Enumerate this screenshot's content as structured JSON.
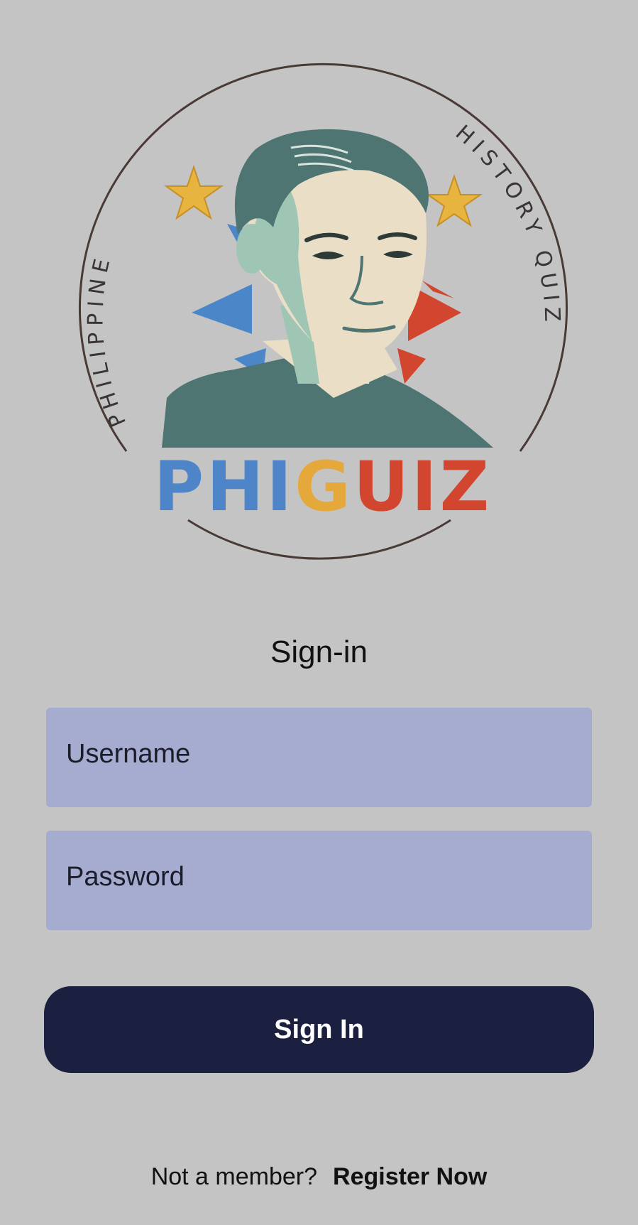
{
  "logo": {
    "arc_text_left": "PHILIPPINE",
    "arc_text_right": "HISTORY QUIZ",
    "wordmark": [
      "PHI",
      "G",
      "UIZ"
    ]
  },
  "form": {
    "title": "Sign-in",
    "username_placeholder": "Username",
    "password_placeholder": "Password",
    "submit_label": "Sign In"
  },
  "footer": {
    "question": "Not a member?",
    "register_link": "Register Now"
  },
  "colors": {
    "background": "#c4c4c4",
    "input_bg": "#a6abd0",
    "button_bg": "#1c2040",
    "wordmark_blue": "#4e84c8",
    "wordmark_yellow": "#e4a93a",
    "wordmark_red": "#d2452f",
    "star_gold": "#e8b440",
    "portrait_teal": "#4e7571"
  },
  "icons": {
    "logo": "phiquiz-emblem",
    "stars": "star-icon"
  }
}
